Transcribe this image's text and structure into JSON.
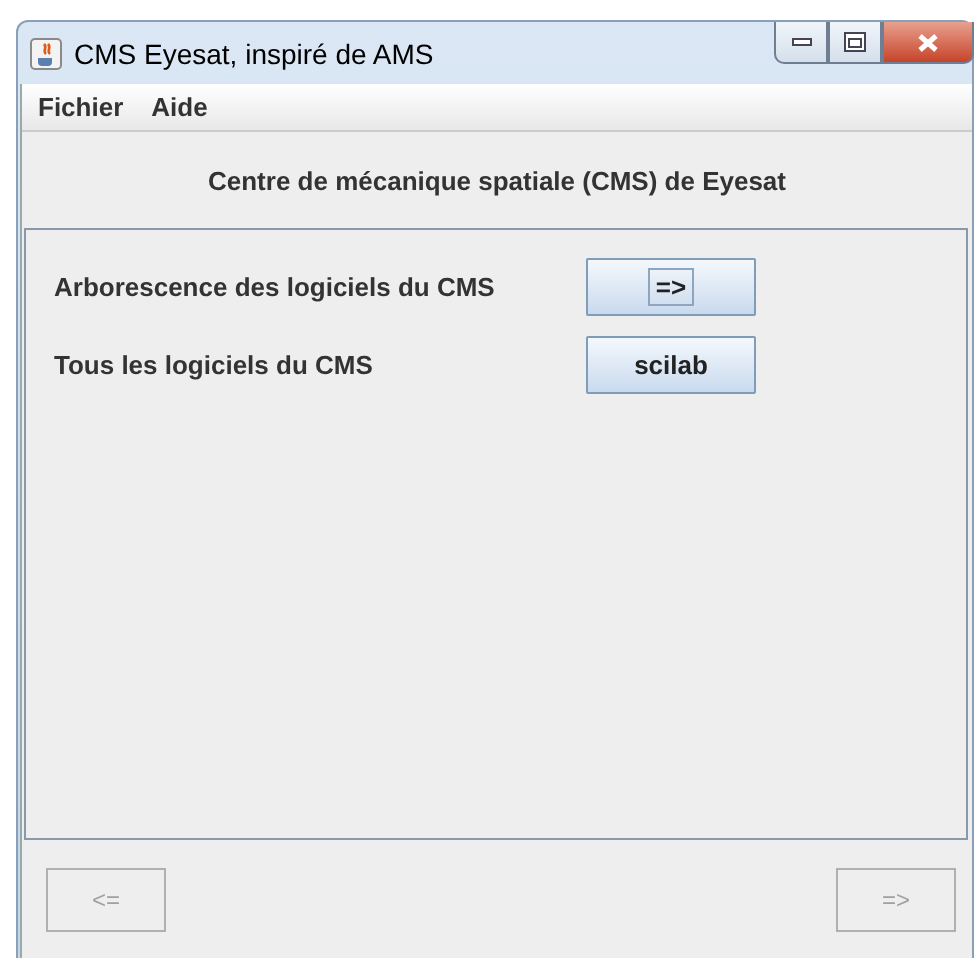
{
  "window": {
    "title": "CMS Eyesat, inspiré de AMS"
  },
  "menu": [
    {
      "label": "Fichier"
    },
    {
      "label": "Aide"
    }
  ],
  "heading": "Centre de mécanique spatiale (CMS) de Eyesat",
  "rows": [
    {
      "label": "Arborescence des logiciels du CMS",
      "button": "=>",
      "focused": true
    },
    {
      "label": "Tous les logiciels du CMS",
      "button": "scilab",
      "focused": false
    }
  ],
  "nav": [
    {
      "label": "<=",
      "disabled": true
    },
    {
      "label": "=>",
      "disabled": true
    }
  ]
}
